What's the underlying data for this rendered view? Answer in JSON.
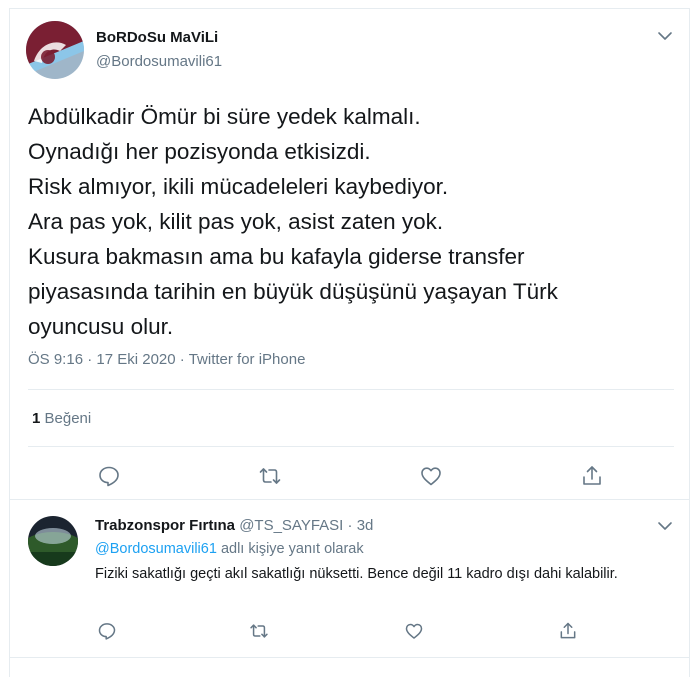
{
  "tweet": {
    "display_name": "BoRDoSu MaViLi",
    "handle": "@Bordosumavili61",
    "text_lines": [
      "Abdülkadir Ömür bi süre yedek kalmalı.",
      "Oynadığı her pozisyonda etkisizdi.",
      "Risk almıyor, ikili mücadeleleri kaybediyor.",
      "Ara pas yok, kilit pas yok, asist zaten yok.",
      "Kusura bakmasın ama bu kafayla giderse transfer",
      "piyasasında tarihin en büyük düşüşünü yaşayan Türk",
      "oyuncusu olur."
    ],
    "time": "ÖS 9:16",
    "date": "17 Eki 2020",
    "source": "Twitter for iPhone",
    "likes_count": "1",
    "likes_label": "Beğeni",
    "icons": {
      "menu": "chevron-down-icon",
      "reply": "reply-icon",
      "retweet": "retweet-icon",
      "like": "heart-icon",
      "share": "share-icon"
    }
  },
  "reply": {
    "display_name": "Trabzonspor Fırtına",
    "handle": "@TS_SAYFASI",
    "time": "3d",
    "replying_mention": "@Bordosumavili61",
    "replying_suffix": "adlı kişiye yanıt olarak",
    "text": "Fiziki sakatlığı geçti akıl sakatlığı nüksetti. Bence değil 11 kadro dışı dahi kalabilir."
  },
  "colors": {
    "text": "#14171a",
    "secondary": "#657786",
    "accent": "#1da1f2",
    "divider": "#e6ecf0",
    "brand_bordo": "#7a1f33",
    "brand_mavi": "#8cc6e8"
  }
}
